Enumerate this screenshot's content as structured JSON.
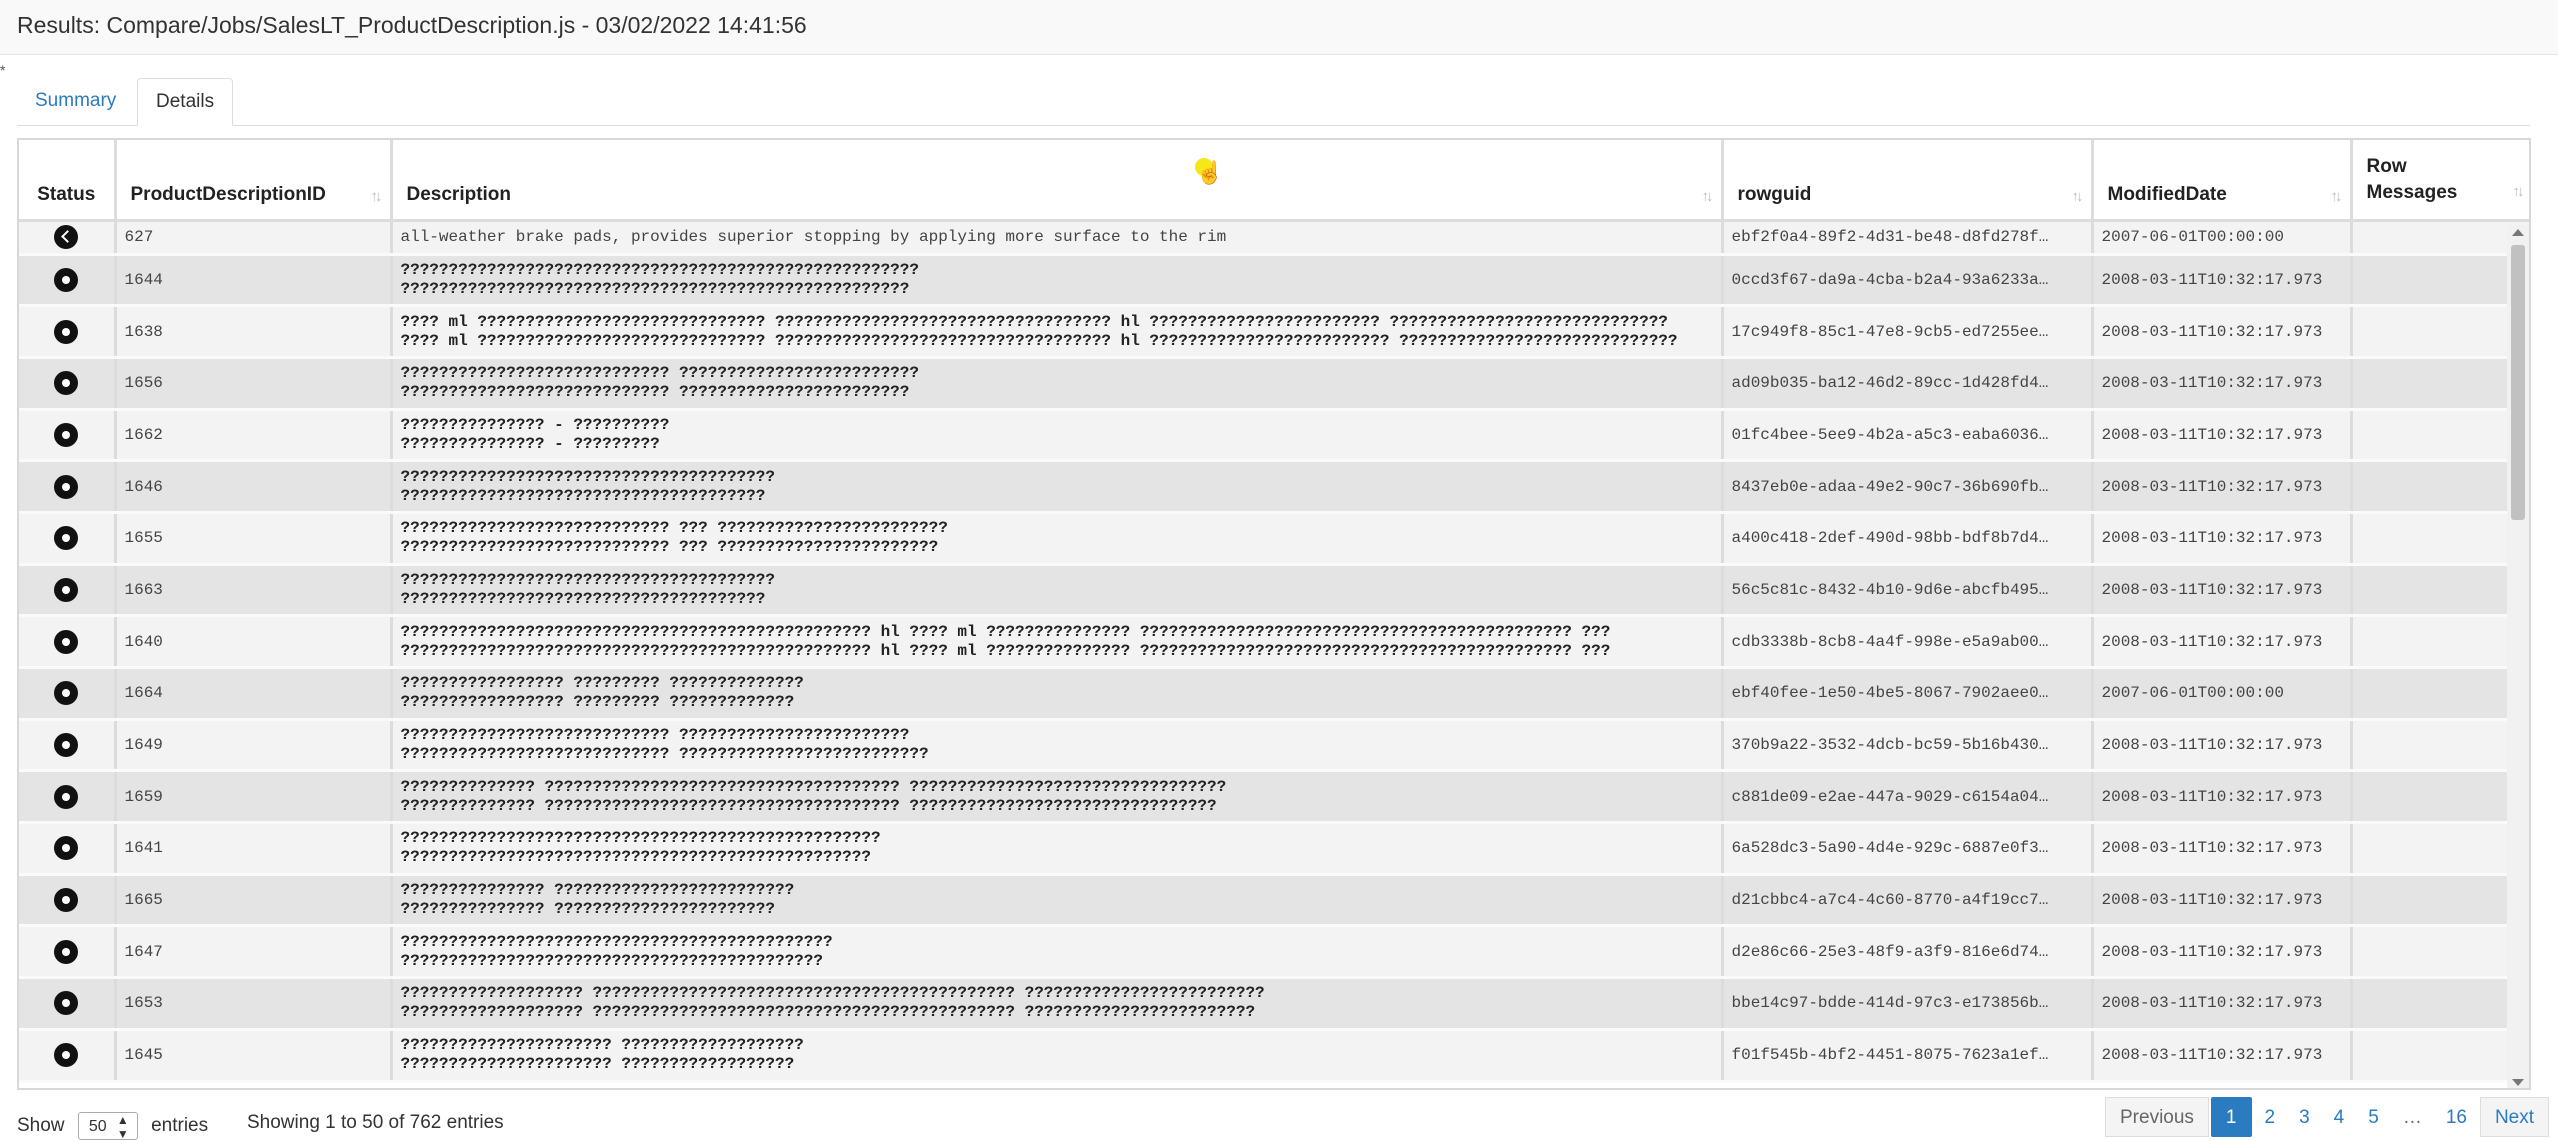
{
  "window": {
    "title": "Results: Compare/Jobs/SalesLT_ProductDescription.js - 03/02/2022 14:41:56",
    "corner_mark": "*"
  },
  "tabs": [
    {
      "label": "Summary",
      "active": false
    },
    {
      "label": "Details",
      "active": true
    }
  ],
  "grid": {
    "headers": {
      "status": "Status",
      "id": "ProductDescriptionID",
      "description": "Description",
      "rowguid": "rowguid",
      "modified": "ModifiedDate",
      "row_messages": "Row Messages"
    },
    "sort_icon": "sort-arrows-icon",
    "rows": [
      {
        "status_icon": "back-arrow-circle-icon",
        "id": "627",
        "desc1": "all-weather brake pads, provides superior stopping by applying more surface to the rim",
        "desc2": "",
        "rowguid": "ebf2f0a4-89f2-4d31-be48-d8fd278f…",
        "modified": "2007-06-01T00:00:00",
        "messages": ""
      },
      {
        "status_icon": "dot-circle-icon",
        "id": "1644",
        "desc1": "??????????????????????????????????????????????????????",
        "desc2": "?????????????????????????????????????????????????????",
        "rowguid": "0ccd3f67-da9a-4cba-b2a4-93a6233a…",
        "modified": "2008-03-11T10:32:17.973",
        "messages": ""
      },
      {
        "status_icon": "dot-circle-icon",
        "id": "1638",
        "desc1": "???? ml ?????????????????????????????? ??????????????????????????????????? hl ???????????????????????? ?????????????????????????????",
        "desc2": "???? ml ?????????????????????????????? ??????????????????????????????????? hl ????????????????????????? ?????????????????????????????",
        "rowguid": "17c949f8-85c1-47e8-9cb5-ed7255ee…",
        "modified": "2008-03-11T10:32:17.973",
        "messages": ""
      },
      {
        "status_icon": "dot-circle-icon",
        "id": "1656",
        "desc1": "???????????????????????????? ?????????????????????????",
        "desc2": "???????????????????????????? ????????????????????????",
        "rowguid": "ad09b035-ba12-46d2-89cc-1d428fd4…",
        "modified": "2008-03-11T10:32:17.973",
        "messages": ""
      },
      {
        "status_icon": "dot-circle-icon",
        "id": "1662",
        "desc1": "??????????????? - ??????????",
        "desc2": "??????????????? - ?????????",
        "rowguid": "01fc4bee-5ee9-4b2a-a5c3-eaba6036…",
        "modified": "2008-03-11T10:32:17.973",
        "messages": ""
      },
      {
        "status_icon": "dot-circle-icon",
        "id": "1646",
        "desc1": "???????????????????????????????????????",
        "desc2": "??????????????????????????????????????",
        "rowguid": "8437eb0e-adaa-49e2-90c7-36b690fb…",
        "modified": "2008-03-11T10:32:17.973",
        "messages": ""
      },
      {
        "status_icon": "dot-circle-icon",
        "id": "1655",
        "desc1": "???????????????????????????? ??? ????????????????????????",
        "desc2": "???????????????????????????? ??? ???????????????????????",
        "rowguid": "a400c418-2def-490d-98bb-bdf8b7d4…",
        "modified": "2008-03-11T10:32:17.973",
        "messages": ""
      },
      {
        "status_icon": "dot-circle-icon",
        "id": "1663",
        "desc1": "???????????????????????????????????????",
        "desc2": "??????????????????????????????????????",
        "rowguid": "56c5c81c-8432-4b10-9d6e-abcfb495…",
        "modified": "2008-03-11T10:32:17.973",
        "messages": ""
      },
      {
        "status_icon": "dot-circle-icon",
        "id": "1640",
        "desc1": "????????????????????????????????????????????????? hl ???? ml ??????????????? ????????????????????????????????????????????? ???",
        "desc2": "????????????????????????????????????????????????? hl ???? ml ??????????????? ????????????????????????????????????????????? ???",
        "rowguid": "cdb3338b-8cb8-4a4f-998e-e5a9ab00…",
        "modified": "2008-03-11T10:32:17.973",
        "messages": ""
      },
      {
        "status_icon": "dot-circle-icon",
        "id": "1664",
        "desc1": "????????????????? ????????? ??????????????",
        "desc2": "????????????????? ????????? ?????????????",
        "rowguid": "ebf40fee-1e50-4be5-8067-7902aee0…",
        "modified": "2007-06-01T00:00:00",
        "messages": ""
      },
      {
        "status_icon": "dot-circle-icon",
        "id": "1649",
        "desc1": "???????????????????????????? ????????????????????????",
        "desc2": "???????????????????????????? ??????????????????????????",
        "rowguid": "370b9a22-3532-4dcb-bc59-5b16b430…",
        "modified": "2008-03-11T10:32:17.973",
        "messages": ""
      },
      {
        "status_icon": "dot-circle-icon",
        "id": "1659",
        "desc1": "?????????????? ????????????????????????????????????? ?????????????????????????????????",
        "desc2": "?????????????? ????????????????????????????????????? ????????????????????????????????",
        "rowguid": "c881de09-e2ae-447a-9029-c6154a04…",
        "modified": "2008-03-11T10:32:17.973",
        "messages": ""
      },
      {
        "status_icon": "dot-circle-icon",
        "id": "1641",
        "desc1": "??????????????????????????????????????????????????",
        "desc2": "?????????????????????????????????????????????????",
        "rowguid": "6a528dc3-5a90-4d4e-929c-6887e0f3…",
        "modified": "2008-03-11T10:32:17.973",
        "messages": ""
      },
      {
        "status_icon": "dot-circle-icon",
        "id": "1665",
        "desc1": "??????????????? ?????????????????????????",
        "desc2": "??????????????? ???????????????????????",
        "rowguid": "d21cbbc4-a7c4-4c60-8770-a4f19cc7…",
        "modified": "2008-03-11T10:32:17.973",
        "messages": ""
      },
      {
        "status_icon": "dot-circle-icon",
        "id": "1647",
        "desc1": "?????????????????????????????????????????????",
        "desc2": "????????????????????????????????????????????",
        "rowguid": "d2e86c66-25e3-48f9-a3f9-816e6d74…",
        "modified": "2008-03-11T10:32:17.973",
        "messages": ""
      },
      {
        "status_icon": "dot-circle-icon",
        "id": "1653",
        "desc1": "??????????????????? ???????????????????????????????????????????? ?????????????????????????",
        "desc2": "??????????????????? ???????????????????????????????????????????? ????????????????????????",
        "rowguid": "bbe14c97-bdde-414d-97c3-e173856b…",
        "modified": "2008-03-11T10:32:17.973",
        "messages": ""
      },
      {
        "status_icon": "dot-circle-icon",
        "id": "1645",
        "desc1": "?????????????????????? ???????????????????",
        "desc2": "?????????????????????? ??????????????????",
        "rowguid": "f01f545b-4bf2-4451-8075-7623a1ef…",
        "modified": "2008-03-11T10:32:17.973",
        "messages": ""
      }
    ]
  },
  "footer": {
    "show_label": "Show",
    "page_size": "50",
    "entries_label": "entries",
    "info": "Showing 1 to 50 of 762 entries"
  },
  "pagination": {
    "previous": "Previous",
    "pages": [
      "1",
      "2",
      "3",
      "4",
      "5",
      "…",
      "16"
    ],
    "active_page": "1",
    "next": "Next"
  },
  "colors": {
    "accent": "#2a7bc0",
    "row_odd": "#e4e4e4",
    "row_even": "#f3f3f3",
    "cursor_highlight": "#f5e400"
  }
}
